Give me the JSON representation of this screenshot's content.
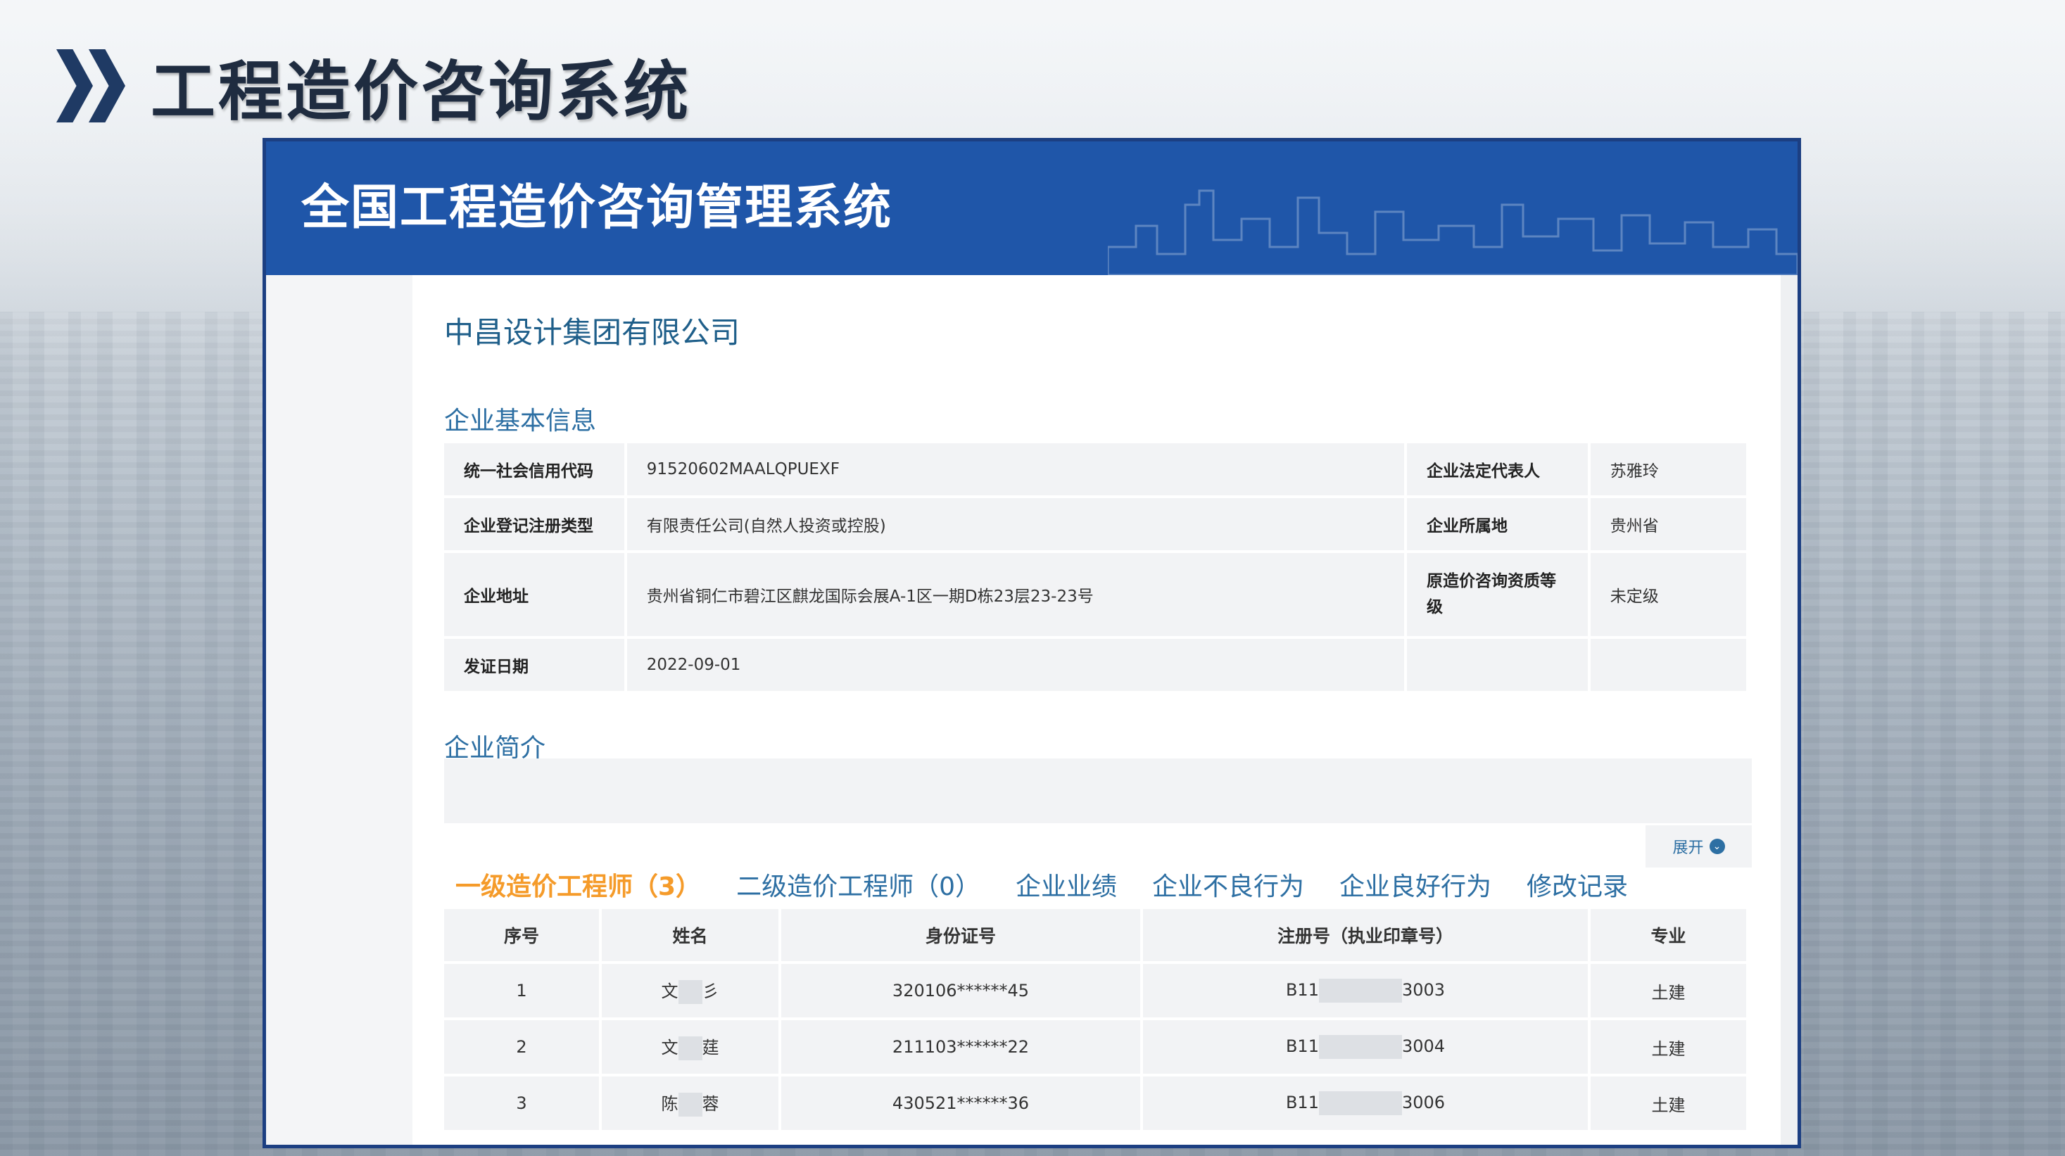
{
  "slide": {
    "title": "工程造价咨询系统"
  },
  "window": {
    "title": "全国工程造价咨询管理系统"
  },
  "company": {
    "name": "中昌设计集团有限公司"
  },
  "basic_info": {
    "section_title": "企业基本信息",
    "rows": [
      {
        "label1": "统一社会信用代码",
        "value1": "91520602MAALQPUEXF",
        "label2": "企业法定代表人",
        "value2": "苏雅玲"
      },
      {
        "label1": "企业登记注册类型",
        "value1": "有限责任公司(自然人投资或控股)",
        "label2": "企业所属地",
        "value2": "贵州省"
      },
      {
        "label1": "企业地址",
        "value1": "贵州省铜仁市碧江区麒龙国际会展A-1区一期D栋23层23-23号",
        "label2": "原造价咨询资质等级",
        "value2": "未定级"
      },
      {
        "label1": "发证日期",
        "value1": "2022-09-01",
        "label2": "",
        "value2": ""
      }
    ]
  },
  "intro": {
    "section_title": "企业简介",
    "expand_label": "展开"
  },
  "tabs": [
    {
      "label": "一级造价工程师（3）",
      "active": true
    },
    {
      "label": "二级造价工程师（0）",
      "active": false
    },
    {
      "label": "企业业绩",
      "active": false
    },
    {
      "label": "企业不良行为",
      "active": false
    },
    {
      "label": "企业良好行为",
      "active": false
    },
    {
      "label": "修改记录",
      "active": false
    }
  ],
  "engineers": {
    "columns": [
      "序号",
      "姓名",
      "身份证号",
      "注册号（执业印章号）",
      "专业"
    ],
    "rows": [
      {
        "no": "1",
        "name_first": "文",
        "name_last": "彡",
        "id": "320106******45",
        "reg_prefix": "B11",
        "reg_suffix": "3003",
        "major": "土建"
      },
      {
        "no": "2",
        "name_first": "文",
        "name_last": "莛",
        "id": "211103******22",
        "reg_prefix": "B11",
        "reg_suffix": "3004",
        "major": "土建"
      },
      {
        "no": "3",
        "name_first": "陈",
        "name_last": "蓉",
        "id": "430521******36",
        "reg_prefix": "B11",
        "reg_suffix": "3006",
        "major": "土建"
      }
    ]
  },
  "colors": {
    "header_blue": "#1f56a9",
    "frame": "#1c3f82",
    "tab_active": "#f59b2a",
    "link_blue": "#2d6fa3"
  }
}
